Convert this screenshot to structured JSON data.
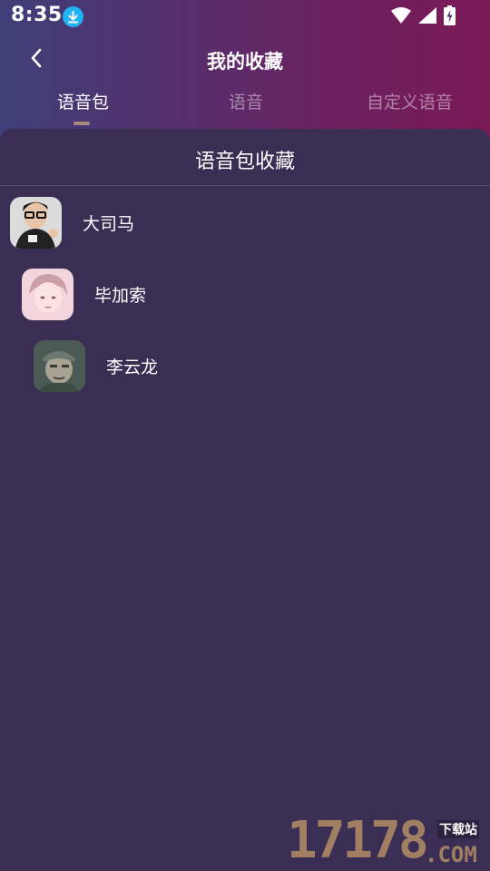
{
  "status_bar": {
    "time": "8:35"
  },
  "header": {
    "title": "我的收藏"
  },
  "tabs": [
    {
      "label": "语音包",
      "active": true
    },
    {
      "label": "语音",
      "active": false
    },
    {
      "label": "自定义语音",
      "active": false
    }
  ],
  "sheet": {
    "title": "语音包收藏",
    "items": [
      {
        "name": "大司马",
        "avatar": "avatar-man-glasses"
      },
      {
        "name": "毕加索",
        "avatar": "avatar-anime-boy"
      },
      {
        "name": "李云龙",
        "avatar": "avatar-man-cap"
      }
    ]
  },
  "watermark": {
    "number": "17178",
    "tag": "下载站",
    "suffix": ".COM"
  },
  "colors": {
    "background": "#3a2e55",
    "header_gradient_left": "#3f3f78",
    "header_gradient_right": "#7a1a55",
    "tab_indicator": "#a48d7e",
    "download_badge": "#20b2f2"
  }
}
